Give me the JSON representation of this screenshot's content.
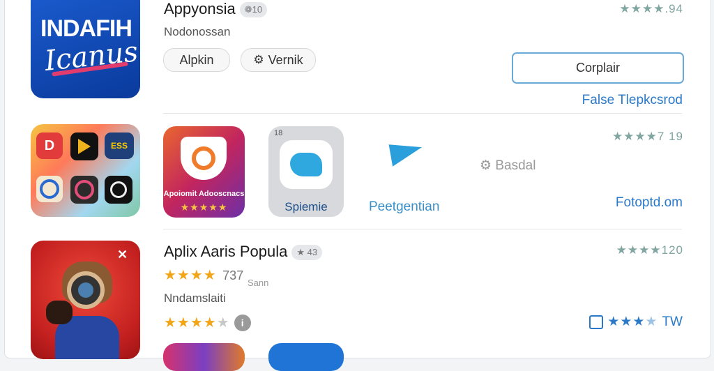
{
  "row1": {
    "title": "Appyonsia",
    "badge": "❁10",
    "subtitle": "Nodonossan",
    "tag1": "Alpkin",
    "tag2": "Vernik",
    "rating": "★★★★.94",
    "button": "Corplair",
    "link": "False Tlepkcsrod",
    "icon_text1": "INDAFIH",
    "icon_text2": "Icanus"
  },
  "row2": {
    "app2_label": "Apoiomit Adooscnacs",
    "app3_label": "Spiemie",
    "app3_badge": "18",
    "app4_label": "Peetgentian",
    "settings_label": "Basdal",
    "rating": "★★★★7 19",
    "link": "Fotoptd.om"
  },
  "row3": {
    "title": "Aplix Aaris Popula",
    "badge": "★ 43",
    "rating_value": "737",
    "rating_sub": "Sann",
    "subtitle": "Nndamslaiti",
    "rating": "★★★★120",
    "right_rating": "TW",
    "close": "✕"
  },
  "colors": {
    "accent": "#2a79c9",
    "button_border": "#6aa8d6",
    "star_gold": "#f2a516",
    "rating_teal": "#7fa6a0"
  }
}
